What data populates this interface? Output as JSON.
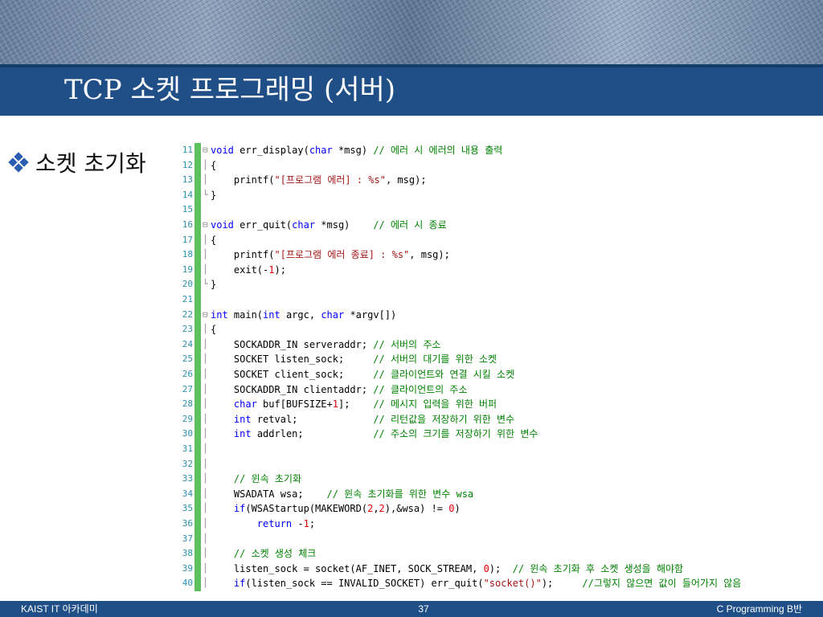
{
  "slide": {
    "title": "TCP 소켓 프로그래밍 (서버)",
    "bullet": "소켓 초기화",
    "footer_left": "KAIST IT 아카데미",
    "page_number": "37",
    "footer_right": "C Programming B반"
  },
  "code": {
    "lines": [
      {
        "n": "11",
        "fold": "⊟",
        "parts": [
          {
            "c": "kw",
            "t": "void"
          },
          {
            "c": "",
            "t": " err_display("
          },
          {
            "c": "kw",
            "t": "char"
          },
          {
            "c": "",
            "t": " *msg) "
          },
          {
            "c": "cm",
            "t": "// 에러 시 에러의 내용 출력"
          }
        ]
      },
      {
        "n": "12",
        "fold": "│",
        "parts": [
          {
            "c": "",
            "t": "{"
          }
        ]
      },
      {
        "n": "13",
        "fold": "│",
        "parts": [
          {
            "c": "",
            "t": "    printf("
          },
          {
            "c": "st",
            "t": "\"[프로그램 에러] : %s\""
          },
          {
            "c": "",
            "t": ", msg);"
          }
        ]
      },
      {
        "n": "14",
        "fold": "└",
        "parts": [
          {
            "c": "",
            "t": "}"
          }
        ]
      },
      {
        "n": "15",
        "fold": "",
        "parts": []
      },
      {
        "n": "16",
        "fold": "⊟",
        "parts": [
          {
            "c": "kw",
            "t": "void"
          },
          {
            "c": "",
            "t": " err_quit("
          },
          {
            "c": "kw",
            "t": "char"
          },
          {
            "c": "",
            "t": " *msg)    "
          },
          {
            "c": "cm",
            "t": "// 에러 시 종료"
          }
        ]
      },
      {
        "n": "17",
        "fold": "│",
        "parts": [
          {
            "c": "",
            "t": "{"
          }
        ]
      },
      {
        "n": "18",
        "fold": "│",
        "parts": [
          {
            "c": "",
            "t": "    printf("
          },
          {
            "c": "st",
            "t": "\"[프로그램 에러 종료] : %s\""
          },
          {
            "c": "",
            "t": ", msg);"
          }
        ]
      },
      {
        "n": "19",
        "fold": "│",
        "parts": [
          {
            "c": "",
            "t": "    exit(-"
          },
          {
            "c": "nm",
            "t": "1"
          },
          {
            "c": "",
            "t": ");"
          }
        ]
      },
      {
        "n": "20",
        "fold": "└",
        "parts": [
          {
            "c": "",
            "t": "}"
          }
        ]
      },
      {
        "n": "21",
        "fold": "",
        "parts": []
      },
      {
        "n": "22",
        "fold": "⊟",
        "parts": [
          {
            "c": "kw",
            "t": "int"
          },
          {
            "c": "",
            "t": " main("
          },
          {
            "c": "kw",
            "t": "int"
          },
          {
            "c": "",
            "t": " argc, "
          },
          {
            "c": "kw",
            "t": "char"
          },
          {
            "c": "",
            "t": " *argv[])"
          }
        ]
      },
      {
        "n": "23",
        "fold": "│",
        "parts": [
          {
            "c": "",
            "t": "{"
          }
        ]
      },
      {
        "n": "24",
        "fold": "│",
        "parts": [
          {
            "c": "",
            "t": "    SOCKADDR_IN serveraddr; "
          },
          {
            "c": "cm",
            "t": "// 서버의 주소"
          }
        ]
      },
      {
        "n": "25",
        "fold": "│",
        "parts": [
          {
            "c": "",
            "t": "    SOCKET listen_sock;     "
          },
          {
            "c": "cm",
            "t": "// 서버의 대기를 위한 소켓"
          }
        ]
      },
      {
        "n": "26",
        "fold": "│",
        "parts": [
          {
            "c": "",
            "t": "    SOCKET client_sock;     "
          },
          {
            "c": "cm",
            "t": "// 클라이언트와 연결 시킬 소켓"
          }
        ]
      },
      {
        "n": "27",
        "fold": "│",
        "parts": [
          {
            "c": "",
            "t": "    SOCKADDR_IN clientaddr; "
          },
          {
            "c": "cm",
            "t": "// 클라이언트의 주소"
          }
        ]
      },
      {
        "n": "28",
        "fold": "│",
        "parts": [
          {
            "c": "",
            "t": "    "
          },
          {
            "c": "kw",
            "t": "char"
          },
          {
            "c": "",
            "t": " buf[BUFSIZE+"
          },
          {
            "c": "nm",
            "t": "1"
          },
          {
            "c": "",
            "t": "];    "
          },
          {
            "c": "cm",
            "t": "// 메시지 입력을 위한 버퍼"
          }
        ]
      },
      {
        "n": "29",
        "fold": "│",
        "parts": [
          {
            "c": "",
            "t": "    "
          },
          {
            "c": "kw",
            "t": "int"
          },
          {
            "c": "",
            "t": " retval;             "
          },
          {
            "c": "cm",
            "t": "// 리턴값을 저장하기 위한 변수"
          }
        ]
      },
      {
        "n": "30",
        "fold": "│",
        "parts": [
          {
            "c": "",
            "t": "    "
          },
          {
            "c": "kw",
            "t": "int"
          },
          {
            "c": "",
            "t": " addrlen;            "
          },
          {
            "c": "cm",
            "t": "// 주소의 크기를 저장하기 위한 변수"
          }
        ]
      },
      {
        "n": "31",
        "fold": "│",
        "parts": []
      },
      {
        "n": "32",
        "fold": "│",
        "parts": []
      },
      {
        "n": "33",
        "fold": "│",
        "parts": [
          {
            "c": "",
            "t": "    "
          },
          {
            "c": "cm",
            "t": "// 윈속 초기화"
          }
        ]
      },
      {
        "n": "34",
        "fold": "│",
        "parts": [
          {
            "c": "",
            "t": "    WSADATA wsa;    "
          },
          {
            "c": "cm",
            "t": "// 윈속 초기화를 위한 변수 wsa"
          }
        ]
      },
      {
        "n": "35",
        "fold": "│",
        "parts": [
          {
            "c": "",
            "t": "    "
          },
          {
            "c": "kw",
            "t": "if"
          },
          {
            "c": "",
            "t": "(WSAStartup(MAKEWORD("
          },
          {
            "c": "nm",
            "t": "2"
          },
          {
            "c": "",
            "t": ","
          },
          {
            "c": "nm",
            "t": "2"
          },
          {
            "c": "",
            "t": "),&wsa) != "
          },
          {
            "c": "nm",
            "t": "0"
          },
          {
            "c": "",
            "t": ")"
          }
        ]
      },
      {
        "n": "36",
        "fold": "│",
        "parts": [
          {
            "c": "",
            "t": "        "
          },
          {
            "c": "kw",
            "t": "return"
          },
          {
            "c": "",
            "t": " -"
          },
          {
            "c": "nm",
            "t": "1"
          },
          {
            "c": "",
            "t": ";"
          }
        ]
      },
      {
        "n": "37",
        "fold": "│",
        "parts": []
      },
      {
        "n": "38",
        "fold": "│",
        "parts": [
          {
            "c": "",
            "t": "    "
          },
          {
            "c": "cm",
            "t": "// 소켓 생성 체크"
          }
        ]
      },
      {
        "n": "39",
        "fold": "│",
        "parts": [
          {
            "c": "",
            "t": "    listen_sock = socket(AF_INET, SOCK_STREAM, "
          },
          {
            "c": "nm",
            "t": "0"
          },
          {
            "c": "",
            "t": ");  "
          },
          {
            "c": "cm",
            "t": "// 윈속 초기화 후 소켓 생성을 해야함"
          }
        ]
      },
      {
        "n": "40",
        "fold": "│",
        "parts": [
          {
            "c": "",
            "t": "    "
          },
          {
            "c": "kw",
            "t": "if"
          },
          {
            "c": "",
            "t": "(listen_sock == INVALID_SOCKET) err_quit("
          },
          {
            "c": "st",
            "t": "\"socket()\""
          },
          {
            "c": "",
            "t": ");     "
          },
          {
            "c": "cm",
            "t": "//그렇지 않으면 값이 들어가지 않음"
          }
        ]
      }
    ]
  }
}
